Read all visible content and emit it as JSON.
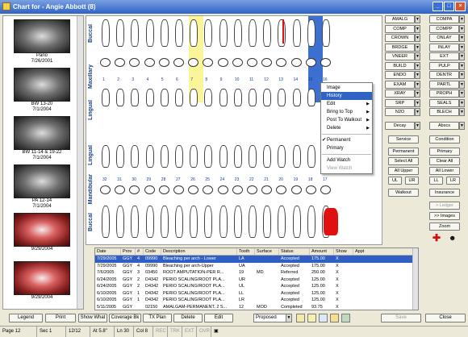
{
  "window": {
    "title": "Chart for - Angie Abbott (8)"
  },
  "images": [
    {
      "label": "Pano",
      "date": "7/26/2001"
    },
    {
      "label": "BW 13-20",
      "date": "7/1/2004"
    },
    {
      "label": "BW 11-14 & 19-22",
      "date": "7/1/2004"
    },
    {
      "label": "PA 12-14",
      "date": "7/1/2004"
    },
    {
      "label": "",
      "date": "9/29/2004"
    },
    {
      "label": "",
      "date": "9/29/2004"
    }
  ],
  "chart_labels": {
    "buccal_top": "Buccal",
    "maxillary": "Maxillary",
    "lingual_top": "Lingual",
    "lingual_bottom": "Lingual",
    "mandibular": "Mandibular",
    "buccal_bottom": "Buccal"
  },
  "upper_numbers": [
    "1",
    "2",
    "3",
    "4",
    "5",
    "6",
    "7",
    "8",
    "9",
    "10",
    "11",
    "12",
    "13",
    "14",
    "15",
    "16"
  ],
  "lower_numbers": [
    "32",
    "31",
    "30",
    "29",
    "28",
    "27",
    "26",
    "25",
    "24",
    "23",
    "22",
    "21",
    "20",
    "19",
    "18",
    "17"
  ],
  "context_menu": {
    "items": [
      {
        "label": "Image",
        "selected": false,
        "submenu": false
      },
      {
        "label": "History",
        "selected": true,
        "submenu": false
      },
      {
        "label": "Edit",
        "selected": false,
        "submenu": true
      },
      {
        "label": "Bring to Top",
        "selected": false,
        "submenu": true
      },
      {
        "label": "Post To Walkout",
        "selected": false,
        "submenu": true
      },
      {
        "label": "Delete",
        "selected": false,
        "submenu": true
      }
    ],
    "status_items": [
      {
        "label": "Permanent",
        "checked": true
      },
      {
        "label": "Primary",
        "checked": false
      }
    ],
    "watch_items": [
      {
        "label": "Add Watch",
        "disabled": false
      },
      {
        "label": "View Watch",
        "disabled": true
      }
    ]
  },
  "procedure_buttons_left": [
    "AMALG",
    "COMP",
    "CROWN",
    "BRDGE",
    "VNEER",
    "BUILD",
    "ENDO",
    "EXAM",
    "XRAY",
    "SRP",
    "N2O"
  ],
  "procedure_buttons_right": [
    "COMPA",
    "COMPP",
    "ONLAY",
    "INLAY",
    "EXT",
    "PULP",
    "DENTR",
    "PARTL",
    "PROPH",
    "SEALS",
    "BLECH"
  ],
  "side_buttons": {
    "decay": "Decay",
    "abscs": "Abscs",
    "service": "Service",
    "condition": "Condition",
    "permanent": "Permanent",
    "primary": "Primary",
    "select_all": "Select All",
    "clear_all": "Clear All",
    "all_upper": "All Upper",
    "all_lower": "All Lower",
    "ul": "UL",
    "ur": "UR",
    "ll": "LL",
    "lr": "LR",
    "walkout": "Walkout",
    "insurance": "Insurance",
    "ledger": "> Ledger",
    "images": ">> Images",
    "zoom": "Zoom"
  },
  "grid": {
    "columns": [
      "Date",
      "Prov",
      "#",
      "Code",
      "Description",
      "Tooth",
      "Surface",
      "Status",
      "Amount",
      "Show",
      "Appt"
    ],
    "rows": [
      {
        "date": "7/29/2005",
        "prov": "GGY",
        "num": "4",
        "code": "09990",
        "desc": "Bleaching per arch - Lower",
        "tooth": "LA",
        "surface": "",
        "status": "Accepted",
        "amount": "175.00",
        "show": "X",
        "appt": "",
        "selected": true
      },
      {
        "date": "7/29/2005",
        "prov": "GGY",
        "num": "4",
        "code": "09990",
        "desc": "Bleaching per arch-Upper",
        "tooth": "UA",
        "surface": "",
        "status": "Accepted",
        "amount": "175.00",
        "show": "X",
        "appt": "",
        "selected": false
      },
      {
        "date": "7/6/2005",
        "prov": "GGY",
        "num": "3",
        "code": "03450",
        "desc": "ROOT AMPUTATION-PER R...",
        "tooth": "19",
        "surface": "MD",
        "status": "Referred",
        "amount": "250.00",
        "show": "X",
        "appt": "",
        "selected": false
      },
      {
        "date": "6/24/2005",
        "prov": "GGY",
        "num": "2",
        "code": "D4342",
        "desc": "PERIO SCALING/ROOT PLA...",
        "tooth": "UR",
        "surface": "",
        "status": "Accepted",
        "amount": "125.00",
        "show": "X",
        "appt": "",
        "selected": false
      },
      {
        "date": "6/24/2005",
        "prov": "GGY",
        "num": "2",
        "code": "D4342",
        "desc": "PERIO SCALING/ROOT PLA...",
        "tooth": "UL",
        "surface": "",
        "status": "Accepted",
        "amount": "125.00",
        "show": "X",
        "appt": "",
        "selected": false
      },
      {
        "date": "6/10/2005",
        "prov": "GGY",
        "num": "1",
        "code": "D4342",
        "desc": "PERIO SCALING/ROOT PLA...",
        "tooth": "LL",
        "surface": "",
        "status": "Accepted",
        "amount": "125.00",
        "show": "X",
        "appt": "",
        "selected": false
      },
      {
        "date": "6/10/2005",
        "prov": "GGY",
        "num": "1",
        "code": "D4342",
        "desc": "PERIO SCALING/ROOT PLA...",
        "tooth": "LR",
        "surface": "",
        "status": "Accepted",
        "amount": "125.00",
        "show": "X",
        "appt": "",
        "selected": false
      },
      {
        "date": "5/11/2005",
        "prov": "GGY",
        "num": "",
        "code": "02150",
        "desc": "AMALGAM-PERMANENT, 2 S...",
        "tooth": "12",
        "surface": "MOD",
        "status": "Completed",
        "amount": "93.75",
        "show": "X",
        "appt": "",
        "selected": false
      }
    ]
  },
  "bottom_buttons": {
    "legend": "Legend",
    "print": "Print",
    "show_what": "Show What",
    "coverage": "Coverage Bk",
    "tx_plan": "TX Plan",
    "delete": "Delete",
    "edit": "Edit",
    "save": "Save",
    "close": "Close"
  },
  "status_filter": {
    "value": "Proposed"
  },
  "statusbar": {
    "page": "Page 12",
    "sec": "Sec 1",
    "pos": "12/12",
    "at": "At 5.8\"",
    "ln": "Ln 30",
    "col": "Col 8",
    "rec": "REC",
    "trk": "TRK",
    "ext": "EXT",
    "ovr": "OVR"
  },
  "colors": {
    "selection": "#2f5fc4",
    "highlight_yellow": "#fbf59a",
    "highlight_blue": "#3c6fd0",
    "title_label": "#1a3c8a"
  }
}
